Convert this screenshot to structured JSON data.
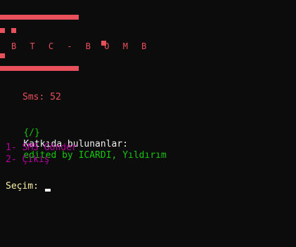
{
  "banner": {
    "logo_text": "B T C - B O M B",
    "color": "#e8505b"
  },
  "sms_line": "Sms: 52",
  "contributors": {
    "prefix": "{/}",
    "label": "Katkıda bulunanlar:",
    "value": "edited by ICARDI, Yıldırım"
  },
  "menu": {
    "items": [
      {
        "label": "1- SMS Gönder"
      },
      {
        "label": "2- Çıkış"
      }
    ]
  },
  "prompt": {
    "label": "Seçim:"
  },
  "colors": {
    "background": "#0c0c0c",
    "red": "#e8505b",
    "green": "#16c60c",
    "magenta": "#b4009e",
    "yellow": "#f9f1a5",
    "white": "#f2f2f2"
  }
}
